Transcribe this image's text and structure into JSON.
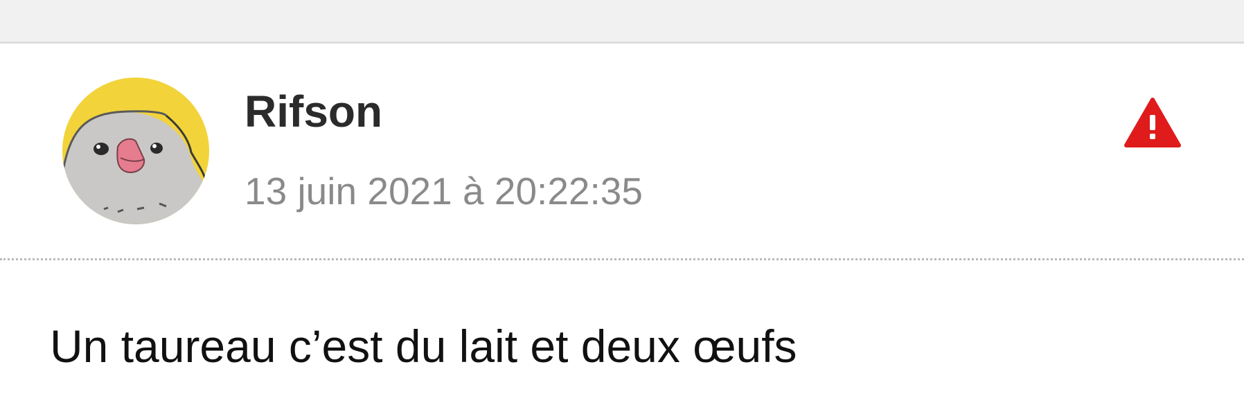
{
  "post": {
    "author": "Rifson",
    "timestamp": "13 juin 2021 à 20:22:35",
    "message": "Un taureau c’est du lait et deux œufs",
    "avatar_icon": "grey-bird-avatar",
    "report_icon": "warning-triangle-icon"
  },
  "colors": {
    "top_band": "#f1f1f1",
    "author_text": "#2b2b2b",
    "timestamp_text": "#8a8a8a",
    "report_icon": "#e01b1b",
    "avatar_background": "#f2d33a",
    "divider": "#b9b9b9"
  }
}
